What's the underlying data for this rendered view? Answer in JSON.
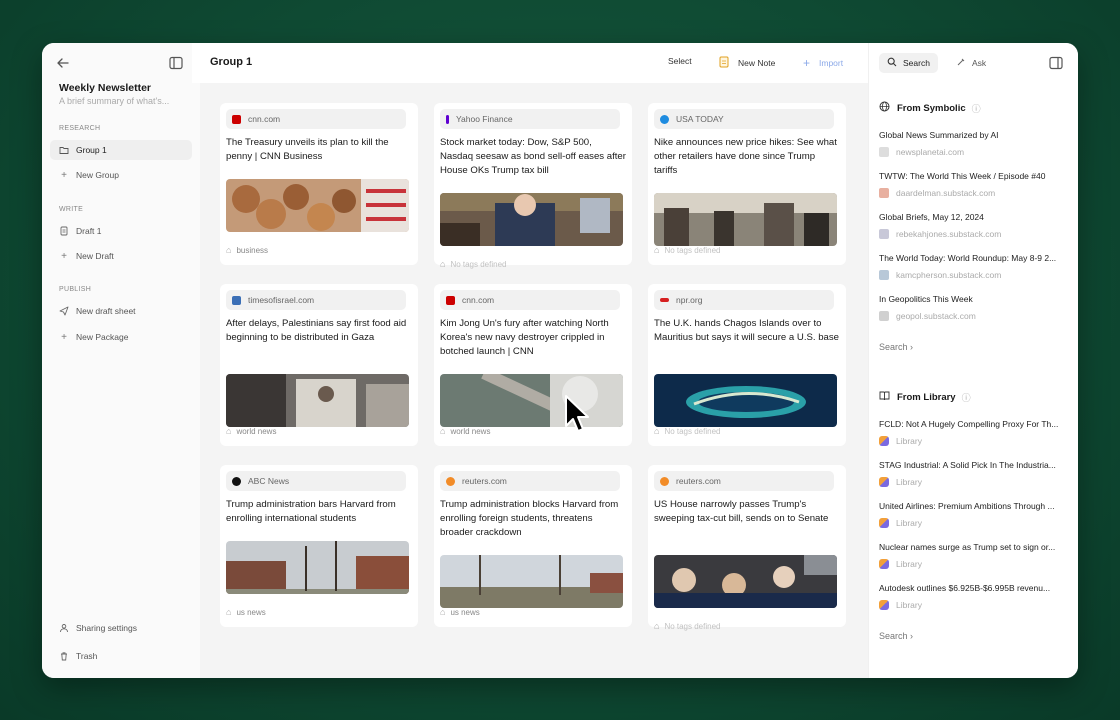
{
  "sidebar": {
    "title": "Weekly Newsletter",
    "subtitle": "A brief summary of what's...",
    "sections": {
      "research": "RESEARCH",
      "write": "WRITE",
      "publish": "PUBLISH"
    },
    "items": {
      "group1": "Group 1",
      "new_group": "New Group",
      "draft1": "Draft 1",
      "new_draft": "New Draft",
      "new_draft_sheet": "New draft sheet",
      "new_package": "New Package",
      "sharing_settings": "Sharing settings",
      "trash": "Trash"
    }
  },
  "header": {
    "title": "Group 1",
    "select_label": "Select",
    "new_note_label": "New Note",
    "import_label": "Import"
  },
  "cards": [
    {
      "source": "cnn.com",
      "headline": "The Treasury unveils its plan to kill the penny | CNN Business",
      "tag": "business",
      "tag_muted": false,
      "favicon_color": "#cc0000"
    },
    {
      "source": "Yahoo Finance",
      "headline": "Stock market today: Dow, S&P 500, Nasdaq seesaw as bond sell-off eases after House OKs Trump tax bill",
      "tag": "No tags defined",
      "tag_muted": true,
      "favicon_color": "#5f01d1"
    },
    {
      "source": "USA TODAY",
      "headline": "Nike announces new price hikes: See what other retailers have done since Trump tariffs",
      "tag": "No tags defined",
      "tag_muted": true,
      "favicon_color": "#1e8ce0"
    },
    {
      "source": "timesofisrael.com",
      "headline": "After delays, Palestinians say first food aid beginning to be distributed in Gaza",
      "tag": "world news",
      "tag_muted": false,
      "favicon_color": "#3b6fb6"
    },
    {
      "source": "cnn.com",
      "headline": "Kim Jong Un's fury after watching North Korea's new navy destroyer crippled in botched launch | CNN",
      "tag": "world news",
      "tag_muted": false,
      "favicon_color": "#cc0000"
    },
    {
      "source": "npr.org",
      "headline": "The U.K. hands Chagos Islands over to Mauritius but says it will secure a U.S. base",
      "tag": "No tags defined",
      "tag_muted": true,
      "favicon_color": "#d62021"
    },
    {
      "source": "ABC News",
      "headline": "Trump administration bars Harvard from enrolling international students",
      "tag": "us news",
      "tag_muted": false,
      "favicon_color": "#111111"
    },
    {
      "source": "reuters.com",
      "headline": "Trump administration blocks Harvard from enrolling foreign students, threatens broader crackdown",
      "tag": "us news",
      "tag_muted": false,
      "favicon_color": "#f28c28"
    },
    {
      "source": "reuters.com",
      "headline": "US House narrowly passes Trump's sweeping tax-cut bill, sends on to Senate",
      "tag": "No tags defined",
      "tag_muted": true,
      "favicon_color": "#f28c28"
    }
  ],
  "right_panel": {
    "search_tab": "Search",
    "ask_tab": "Ask",
    "symbolic": {
      "title": "From Symbolic",
      "items": [
        {
          "title": "Global News Summarized by AI",
          "source": "newsplanetai.com"
        },
        {
          "title": "TWTW: The World This Week / Episode #40",
          "source": "daardelman.substack.com"
        },
        {
          "title": "Global Briefs, May 12, 2024",
          "source": "rebekahjones.substack.com"
        },
        {
          "title": "The World Today: World Roundup: May 8-9 2...",
          "source": "kamcpherson.substack.com"
        },
        {
          "title": "In Geopolitics This Week",
          "source": "geopol.substack.com"
        }
      ],
      "search_label": "Search"
    },
    "library": {
      "title": "From Library",
      "items": [
        {
          "title": "FCLD: Not A Hugely Compelling Proxy For Th...",
          "source": "Library"
        },
        {
          "title": "STAG Industrial: A Solid Pick In The Industria...",
          "source": "Library"
        },
        {
          "title": "United Airlines: Premium Ambitions Through ...",
          "source": "Library"
        },
        {
          "title": "Nuclear names surge as Trump set to sign or...",
          "source": "Library"
        },
        {
          "title": "Autodesk outlines $6.925B-$6.995B revenu...",
          "source": "Library"
        }
      ],
      "search_label": "Search"
    }
  }
}
